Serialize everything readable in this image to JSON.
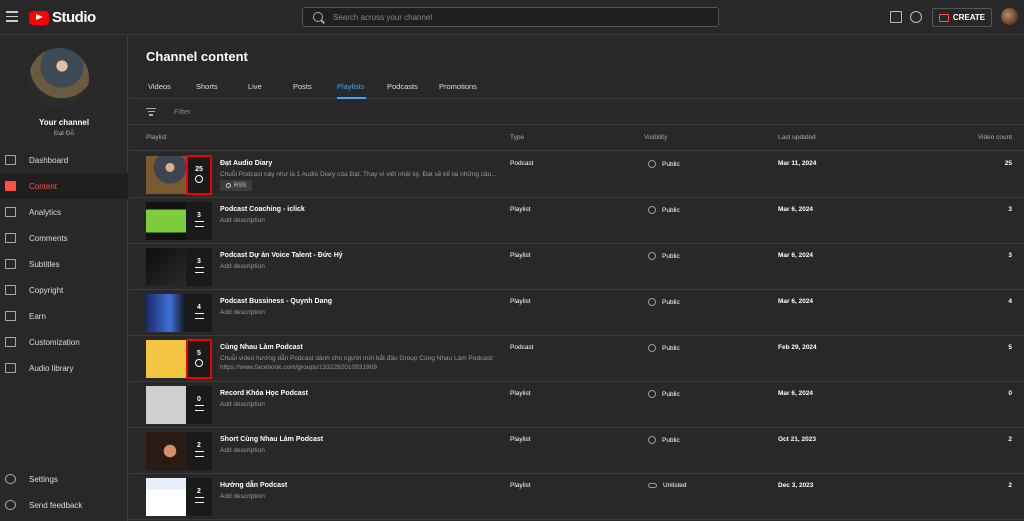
{
  "app": {
    "logo_text": "Studio"
  },
  "search": {
    "placeholder": "Search across your channel"
  },
  "header": {
    "create_label": "CREATE"
  },
  "channel": {
    "title": "Your channel",
    "name": "Đạt Đỗ"
  },
  "nav": [
    {
      "label": "Dashboard",
      "icon": "dashboard-icon",
      "active": false
    },
    {
      "label": "Content",
      "icon": "content-icon",
      "active": true
    },
    {
      "label": "Analytics",
      "icon": "analytics-icon",
      "active": false
    },
    {
      "label": "Comments",
      "icon": "comments-icon",
      "active": false
    },
    {
      "label": "Subtitles",
      "icon": "subtitles-icon",
      "active": false
    },
    {
      "label": "Copyright",
      "icon": "copyright-icon",
      "active": false
    },
    {
      "label": "Earn",
      "icon": "earn-icon",
      "active": false
    },
    {
      "label": "Customization",
      "icon": "customization-icon",
      "active": false
    },
    {
      "label": "Audio library",
      "icon": "audio-library-icon",
      "active": false
    }
  ],
  "nav_bottom": [
    {
      "label": "Settings",
      "icon": "gear-icon"
    },
    {
      "label": "Send feedback",
      "icon": "feedback-icon"
    }
  ],
  "page": {
    "title": "Channel content",
    "tabs": [
      "Videos",
      "Shorts",
      "Live",
      "Posts",
      "Playlists",
      "Podcasts",
      "Promotions"
    ],
    "active_tab": "Playlists",
    "filter_placeholder": "Filter"
  },
  "table": {
    "columns": {
      "playlist": "Playlist",
      "type": "Type",
      "visibility": "Visibility",
      "updated": "Last updated",
      "count": "Video count"
    },
    "rows": [
      {
        "title": "Đạt Audio Diary",
        "desc": "Chuỗi Podcast này như là 1 Audio Diary của Đạt. Thay vì viết nhật ký, Đạt sẽ kể lại những câu...",
        "type": "Podcast",
        "visibility": "Public",
        "updated": "Mar 11, 2024",
        "count": "25",
        "thumb_count": "25",
        "rss": "RSS",
        "highlight": true,
        "podcast": true
      },
      {
        "title": "Podcast Coaching - iclick",
        "desc": "Add description",
        "type": "Playlist",
        "visibility": "Public",
        "updated": "Mar 6, 2024",
        "count": "3",
        "thumb_count": "3",
        "highlight": false,
        "podcast": false
      },
      {
        "title": "Podcast Dự án Voice Talent - Đức Hỷ",
        "desc": "Add description",
        "type": "Playlist",
        "visibility": "Public",
        "updated": "Mar 6, 2024",
        "count": "3",
        "thumb_count": "3",
        "highlight": false,
        "podcast": false
      },
      {
        "title": "Podcast Bussiness - Quynh Dang",
        "desc": "Add description",
        "type": "Playlist",
        "visibility": "Public",
        "updated": "Mar 6, 2024",
        "count": "4",
        "thumb_count": "4",
        "highlight": false,
        "podcast": false
      },
      {
        "title": "Cùng Nhau Làm Podcast",
        "desc": "Chuỗi video hướng dẫn Podcast dành cho người mới bắt đầu Group Cùng Nhau Làm Podcast: https://www.facebook.com/groups/1332282010931909",
        "type": "Podcast",
        "visibility": "Public",
        "updated": "Feb 29, 2024",
        "count": "5",
        "thumb_count": "5",
        "highlight": true,
        "podcast": true
      },
      {
        "title": "Record Khóa Học Podcast",
        "desc": "Add description",
        "type": "Playlist",
        "visibility": "Public",
        "updated": "Mar 6, 2024",
        "count": "0",
        "thumb_count": "0",
        "highlight": false,
        "podcast": false
      },
      {
        "title": "Short Cùng Nhau Làm Podcast",
        "desc": "Add description",
        "type": "Playlist",
        "visibility": "Public",
        "updated": "Oct 21, 2023",
        "count": "2",
        "thumb_count": "2",
        "highlight": false,
        "podcast": false
      },
      {
        "title": "Hướng dẫn Podcast",
        "desc": "Add description",
        "type": "Playlist",
        "visibility": "Unlisted",
        "updated": "Dec 3, 2023",
        "count": "2",
        "thumb_count": "2",
        "highlight": false,
        "podcast": false
      }
    ]
  },
  "colors": {
    "accent": "#ff0000",
    "tab_active": "#3ea6ff",
    "highlight_border": "#ee0000"
  }
}
